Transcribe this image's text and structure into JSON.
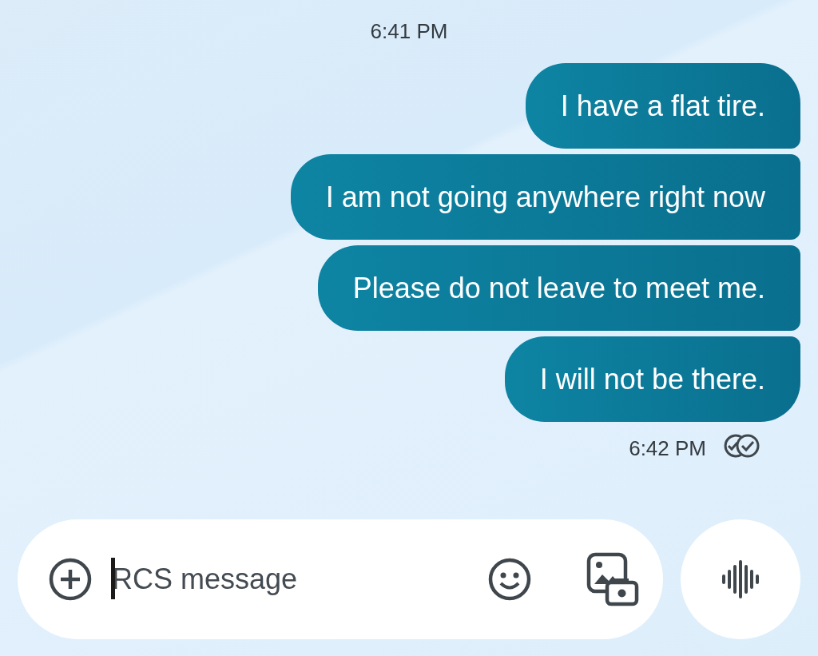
{
  "conversation": {
    "timestamp_top": "6:41 PM",
    "messages": [
      {
        "text": "I have a flat tire."
      },
      {
        "text": "I am not going anywhere right now"
      },
      {
        "text": "Please do not leave to meet me."
      },
      {
        "text": "I will not be there."
      }
    ],
    "timestamp_bottom": "6:42 PM",
    "read": true
  },
  "composer": {
    "placeholder": "RCS message",
    "focused": true
  }
}
